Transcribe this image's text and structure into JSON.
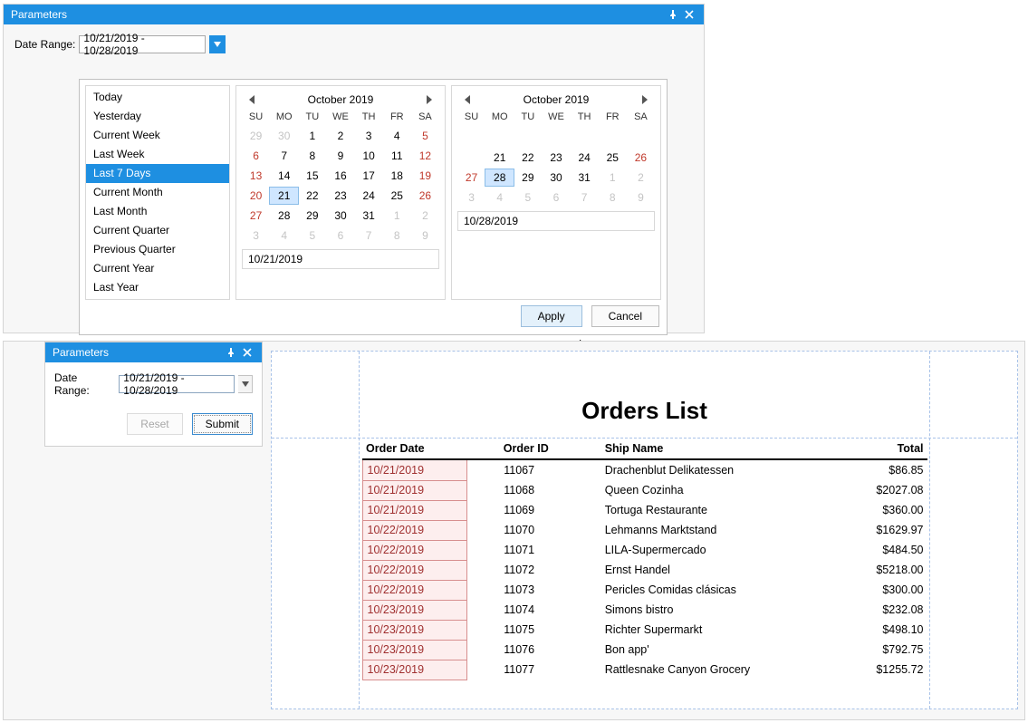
{
  "topPanel": {
    "title": "Parameters",
    "label": "Date Range:",
    "value": "10/21/2019 - 10/28/2019"
  },
  "presets": [
    "Today",
    "Yesterday",
    "Current Week",
    "Last Week",
    "Last 7 Days",
    "Current Month",
    "Last Month",
    "Current Quarter",
    "Previous Quarter",
    "Current Year",
    "Last Year"
  ],
  "presetSelectedIndex": 4,
  "calLeft": {
    "title": "October 2019",
    "dow": [
      "SU",
      "MO",
      "TU",
      "WE",
      "TH",
      "FR",
      "SA"
    ],
    "weeks": [
      [
        {
          "d": "29",
          "o": true
        },
        {
          "d": "30",
          "o": true
        },
        {
          "d": "1"
        },
        {
          "d": "2"
        },
        {
          "d": "3"
        },
        {
          "d": "4"
        },
        {
          "d": "5",
          "w": true
        }
      ],
      [
        {
          "d": "6",
          "w": true
        },
        {
          "d": "7"
        },
        {
          "d": "8"
        },
        {
          "d": "9"
        },
        {
          "d": "10"
        },
        {
          "d": "11"
        },
        {
          "d": "12",
          "w": true
        }
      ],
      [
        {
          "d": "13",
          "w": true
        },
        {
          "d": "14"
        },
        {
          "d": "15"
        },
        {
          "d": "16"
        },
        {
          "d": "17"
        },
        {
          "d": "18"
        },
        {
          "d": "19",
          "w": true
        }
      ],
      [
        {
          "d": "20",
          "w": true
        },
        {
          "d": "21",
          "sel": true
        },
        {
          "d": "22"
        },
        {
          "d": "23"
        },
        {
          "d": "24"
        },
        {
          "d": "25"
        },
        {
          "d": "26",
          "w": true
        }
      ],
      [
        {
          "d": "27",
          "w": true
        },
        {
          "d": "28"
        },
        {
          "d": "29"
        },
        {
          "d": "30"
        },
        {
          "d": "31"
        },
        {
          "d": "1",
          "o": true
        },
        {
          "d": "2",
          "o": true
        }
      ],
      [
        {
          "d": "3",
          "o": true
        },
        {
          "d": "4",
          "o": true
        },
        {
          "d": "5",
          "o": true
        },
        {
          "d": "6",
          "o": true
        },
        {
          "d": "7",
          "o": true
        },
        {
          "d": "8",
          "o": true
        },
        {
          "d": "9",
          "o": true
        }
      ]
    ],
    "input": "10/21/2019"
  },
  "calRight": {
    "title": "October 2019",
    "dow": [
      "SU",
      "MO",
      "TU",
      "WE",
      "TH",
      "FR",
      "SA"
    ],
    "weeks": [
      [
        {
          "h": true
        },
        {
          "h": true
        },
        {
          "h": true
        },
        {
          "h": true
        },
        {
          "h": true
        },
        {
          "h": true
        },
        {
          "h": true
        }
      ],
      [
        {
          "h": true
        },
        {
          "h": true
        },
        {
          "h": true
        },
        {
          "h": true
        },
        {
          "h": true
        },
        {
          "h": true
        },
        {
          "h": true
        }
      ],
      [
        {
          "h": true
        },
        {
          "h": true
        },
        {
          "h": true
        },
        {
          "h": true
        },
        {
          "h": true
        },
        {
          "h": true
        },
        {
          "h": true
        }
      ],
      [
        {
          "h": true
        },
        {
          "d": "21"
        },
        {
          "d": "22"
        },
        {
          "d": "23"
        },
        {
          "d": "24"
        },
        {
          "d": "25"
        },
        {
          "d": "26",
          "w": true
        }
      ],
      [
        {
          "d": "27",
          "w": true
        },
        {
          "d": "28",
          "sel": true
        },
        {
          "d": "29"
        },
        {
          "d": "30"
        },
        {
          "d": "31"
        },
        {
          "d": "1",
          "o": true
        },
        {
          "d": "2",
          "o": true
        }
      ],
      [
        {
          "d": "3",
          "o": true
        },
        {
          "d": "4",
          "o": true
        },
        {
          "d": "5",
          "o": true
        },
        {
          "d": "6",
          "o": true
        },
        {
          "d": "7",
          "o": true
        },
        {
          "d": "8",
          "o": true
        },
        {
          "d": "9",
          "o": true
        }
      ]
    ],
    "input": "10/28/2019"
  },
  "applyLabel": "Apply",
  "cancelLabel": "Cancel",
  "bottomPanel": {
    "title": "Parameters",
    "label": "Date Range:",
    "value": "10/21/2019 - 10/28/2019",
    "resetLabel": "Reset",
    "submitLabel": "Submit"
  },
  "report": {
    "title": "Orders List",
    "columns": [
      "Order Date",
      "Order ID",
      "Ship Name",
      "Total"
    ],
    "rows": [
      {
        "date": "10/21/2019",
        "id": "11067",
        "ship": "Drachenblut Delikatessen",
        "total": "$86.85"
      },
      {
        "date": "10/21/2019",
        "id": "11068",
        "ship": "Queen Cozinha",
        "total": "$2027.08"
      },
      {
        "date": "10/21/2019",
        "id": "11069",
        "ship": "Tortuga Restaurante",
        "total": "$360.00"
      },
      {
        "date": "10/22/2019",
        "id": "11070",
        "ship": "Lehmanns Marktstand",
        "total": "$1629.97"
      },
      {
        "date": "10/22/2019",
        "id": "11071",
        "ship": "LILA-Supermercado",
        "total": "$484.50"
      },
      {
        "date": "10/22/2019",
        "id": "11072",
        "ship": "Ernst Handel",
        "total": "$5218.00"
      },
      {
        "date": "10/22/2019",
        "id": "11073",
        "ship": "Pericles Comidas clásicas",
        "total": "$300.00"
      },
      {
        "date": "10/23/2019",
        "id": "11074",
        "ship": "Simons bistro",
        "total": "$232.08"
      },
      {
        "date": "10/23/2019",
        "id": "11075",
        "ship": "Richter Supermarkt",
        "total": "$498.10"
      },
      {
        "date": "10/23/2019",
        "id": "11076",
        "ship": "Bon app'",
        "total": "$792.75"
      },
      {
        "date": "10/23/2019",
        "id": "11077",
        "ship": "Rattlesnake Canyon Grocery",
        "total": "$1255.72"
      }
    ]
  }
}
